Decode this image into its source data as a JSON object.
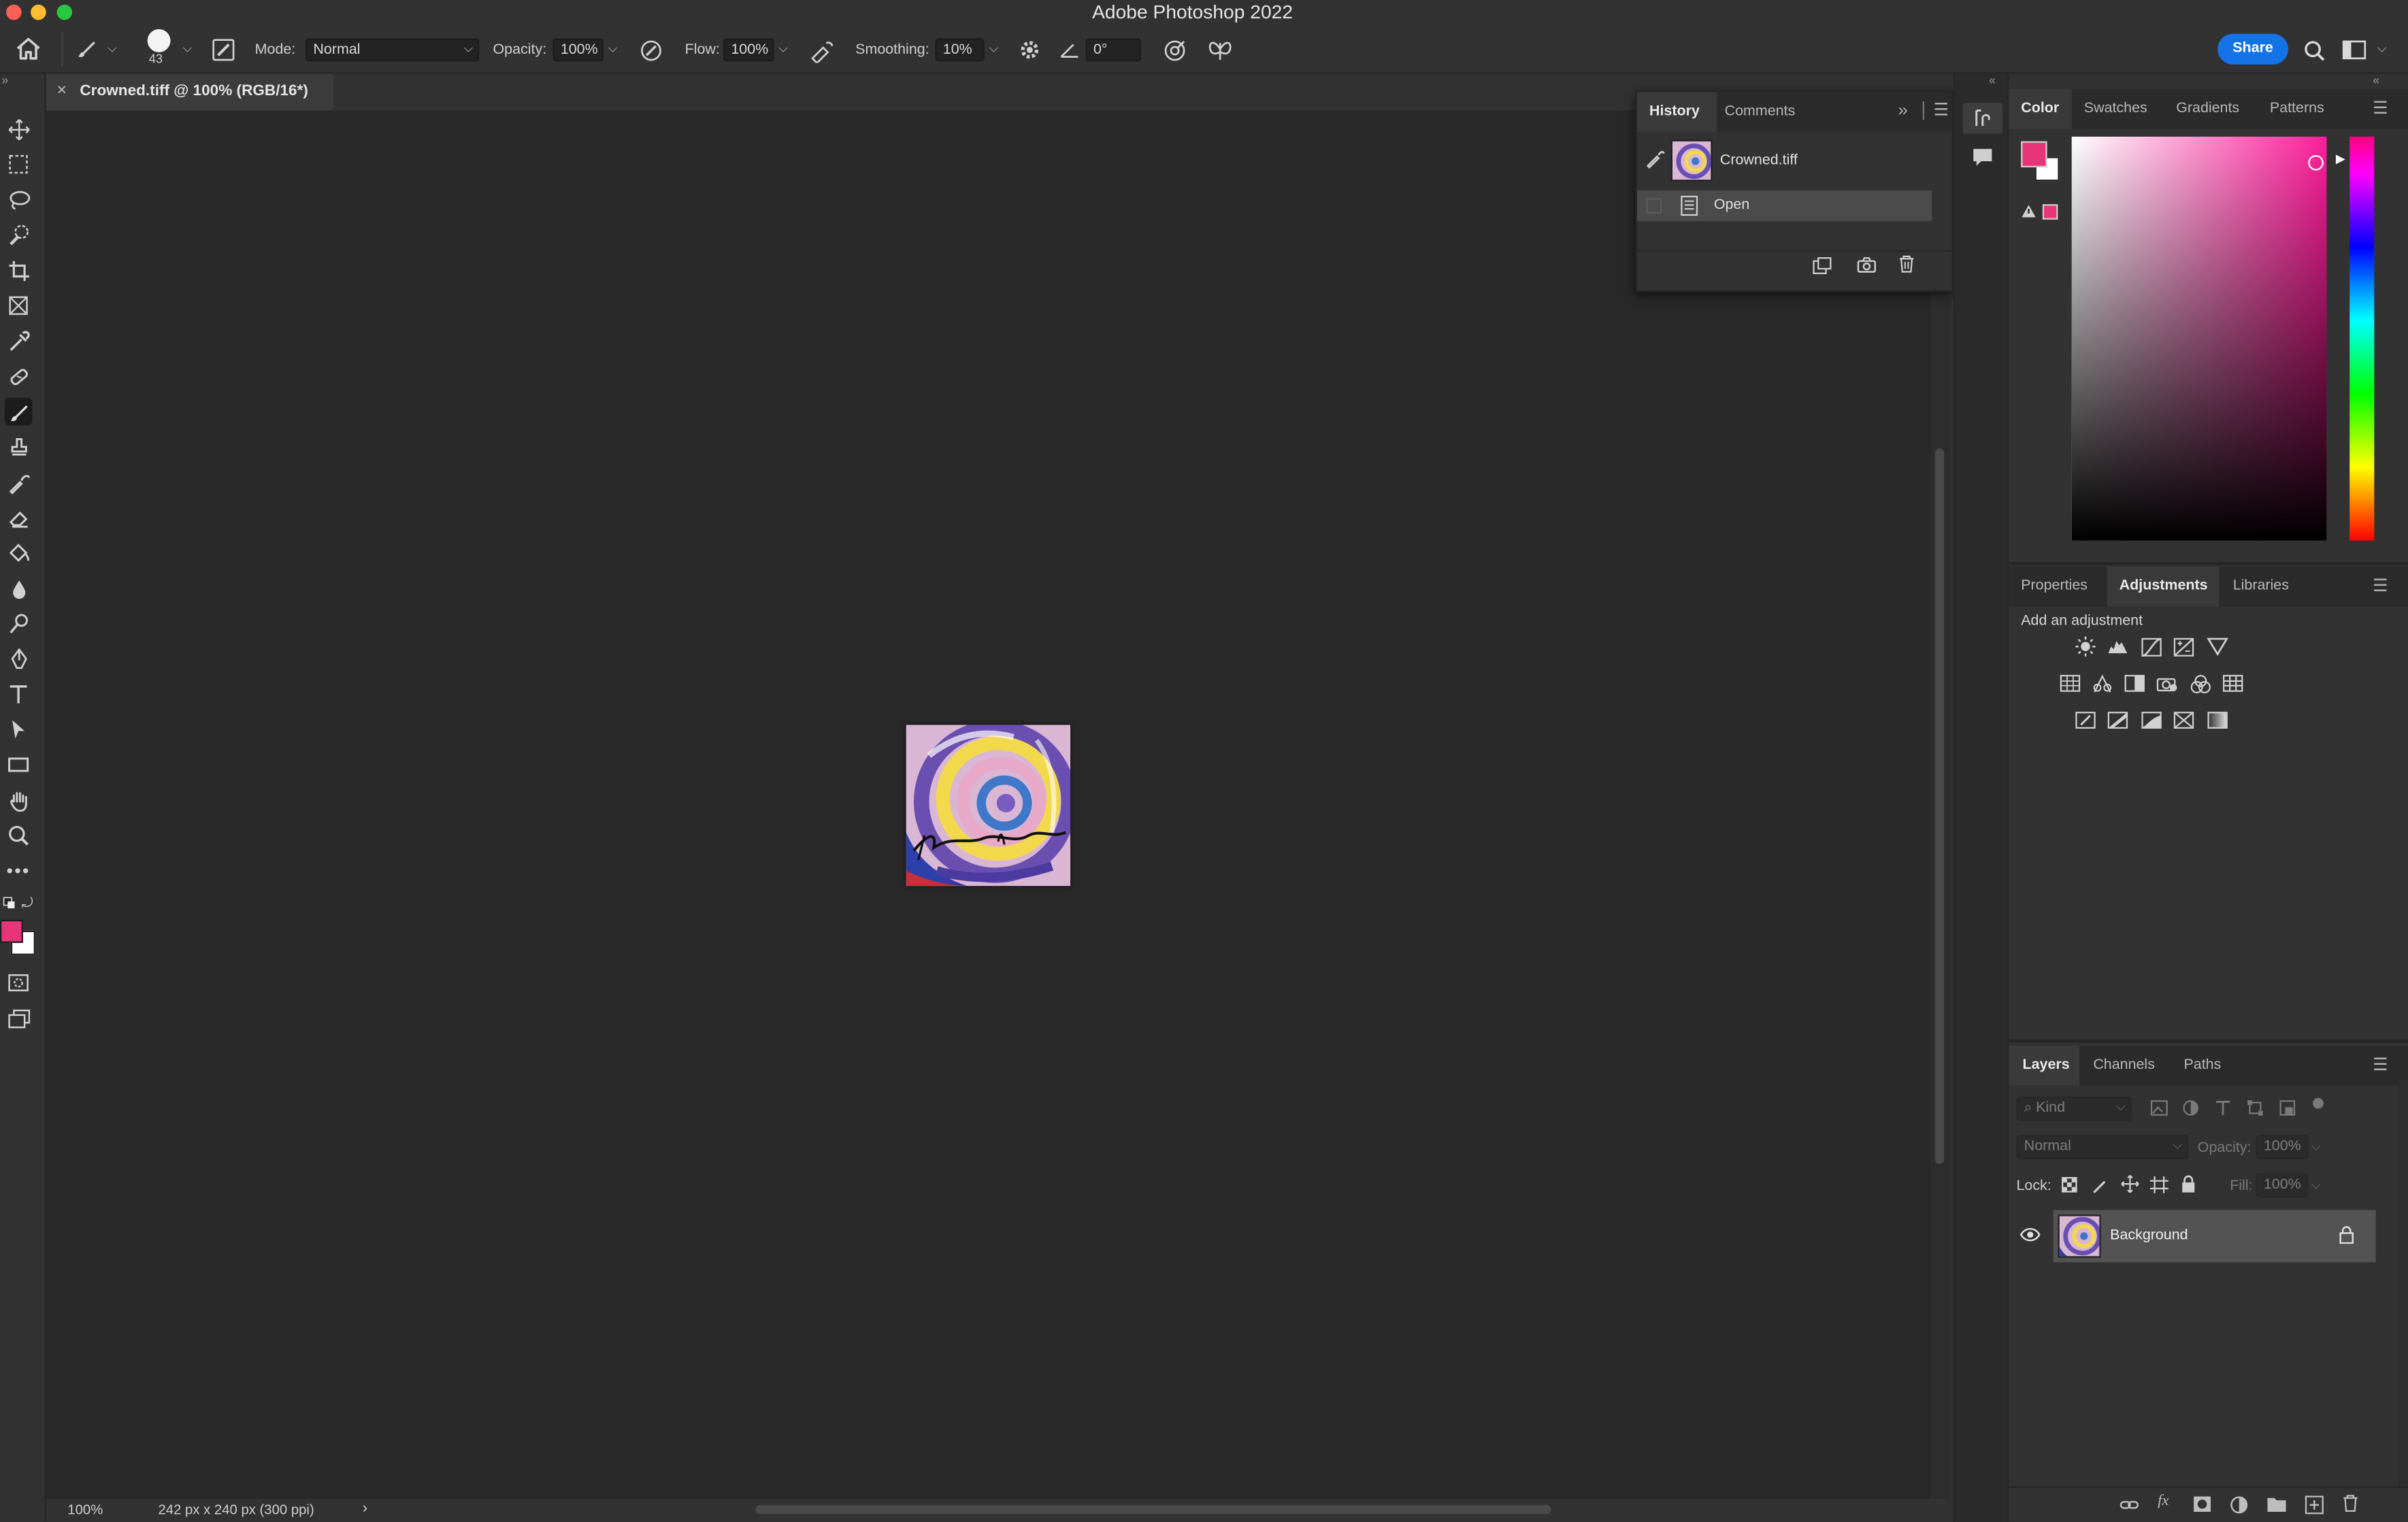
{
  "app": {
    "title": "Adobe Photoshop 2022"
  },
  "options_bar": {
    "brush_size": "43",
    "mode_label": "Mode:",
    "mode_value": "Normal",
    "opacity_label": "Opacity:",
    "opacity_value": "100%",
    "flow_label": "Flow:",
    "flow_value": "100%",
    "smoothing_label": "Smoothing:",
    "smoothing_value": "10%",
    "angle_value": "0°",
    "share_label": "Share"
  },
  "document": {
    "tab_title": "Crowned.tiff @ 100% (RGB/16*)",
    "close_glyph": "×",
    "signature": "Janice N. Burke"
  },
  "status_bar": {
    "zoom": "100%",
    "doc_info": "242 px x 240 px (300 ppi)",
    "arrow": "›"
  },
  "history_panel": {
    "tabs": [
      "History",
      "Comments"
    ],
    "snapshot_name": "Crowned.tiff",
    "states": [
      "Open"
    ]
  },
  "color_panel": {
    "tabs": [
      "Color",
      "Swatches",
      "Gradients",
      "Patterns"
    ],
    "foreground": "#e8357a",
    "background": "#ffffff"
  },
  "adjustments_panel": {
    "tabs": [
      "Properties",
      "Adjustments",
      "Libraries"
    ],
    "heading": "Add an adjustment",
    "icons_row1": [
      "brightness-contrast-icon",
      "levels-icon",
      "curves-icon",
      "exposure-icon",
      "gradient-triangle-icon"
    ],
    "icons_row2": [
      "vibrance-icon",
      "hue-saturation-icon",
      "black-white-icon",
      "photo-filter-icon",
      "channel-mixer-icon",
      "color-lookup-icon"
    ],
    "icons_row3": [
      "invert-icon",
      "posterize-icon",
      "threshold-icon",
      "selective-color-icon",
      "gradient-map-icon"
    ]
  },
  "layers_panel": {
    "tabs": [
      "Layers",
      "Channels",
      "Paths"
    ],
    "filter_placeholder": "Kind",
    "blend_mode": "Normal",
    "opacity_label": "Opacity:",
    "opacity_value": "100%",
    "lock_label": "Lock:",
    "fill_label": "Fill:",
    "fill_value": "100%",
    "layers": [
      {
        "name": "Background",
        "visible": true,
        "locked": true
      }
    ]
  },
  "colors": {
    "accent": "#1473e6",
    "foreground_swatch": "#e8357a"
  }
}
